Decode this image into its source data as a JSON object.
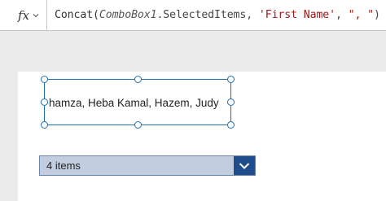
{
  "formula_bar": {
    "fx_label": "fx",
    "formula_parts": {
      "fn_name": "Concat(",
      "control_name": "ComboBox1",
      "rest_plain": ".SelectedItems, ",
      "str1": "'First Name'",
      "sep": ", ",
      "str2": "\", \"",
      "close": ")"
    }
  },
  "canvas": {
    "label_text": "hamza, Heba Kamal, Hazem, Judy",
    "combo": {
      "selected_text": "4 items"
    }
  },
  "colors": {
    "selection_border": "#1f6fb0",
    "combo_fill": "#c2cde0",
    "combo_button": "#1f4d8c"
  }
}
